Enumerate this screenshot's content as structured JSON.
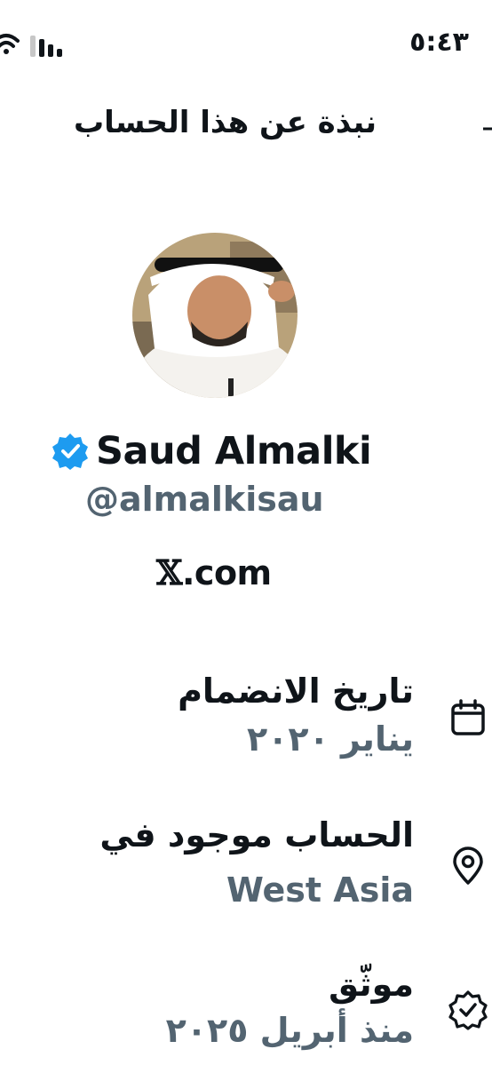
{
  "status_bar": {
    "time": "٥:٤٣"
  },
  "header": {
    "title": "نبذة عن هذا الحساب"
  },
  "profile": {
    "display_name": "Saud Almalki",
    "handle": "@almalkisau",
    "site_link_text": ".com",
    "site_link_mark": "𝕏",
    "verified": true,
    "accent_color": "#1d9bf0"
  },
  "details": [
    {
      "icon": "calendar-icon",
      "label": "تاريخ الانضمام",
      "value": "يناير ٢٠٢٠"
    },
    {
      "icon": "location-pin-icon",
      "label": "الحساب موجود في",
      "value": "West Asia"
    },
    {
      "icon": "verified-badge-outline-icon",
      "label": "موثّق",
      "value": "منذ أبريل ٢٠٢٥"
    }
  ],
  "colors": {
    "text_primary": "#0f1419",
    "text_secondary": "#536471",
    "background": "#ffffff"
  }
}
